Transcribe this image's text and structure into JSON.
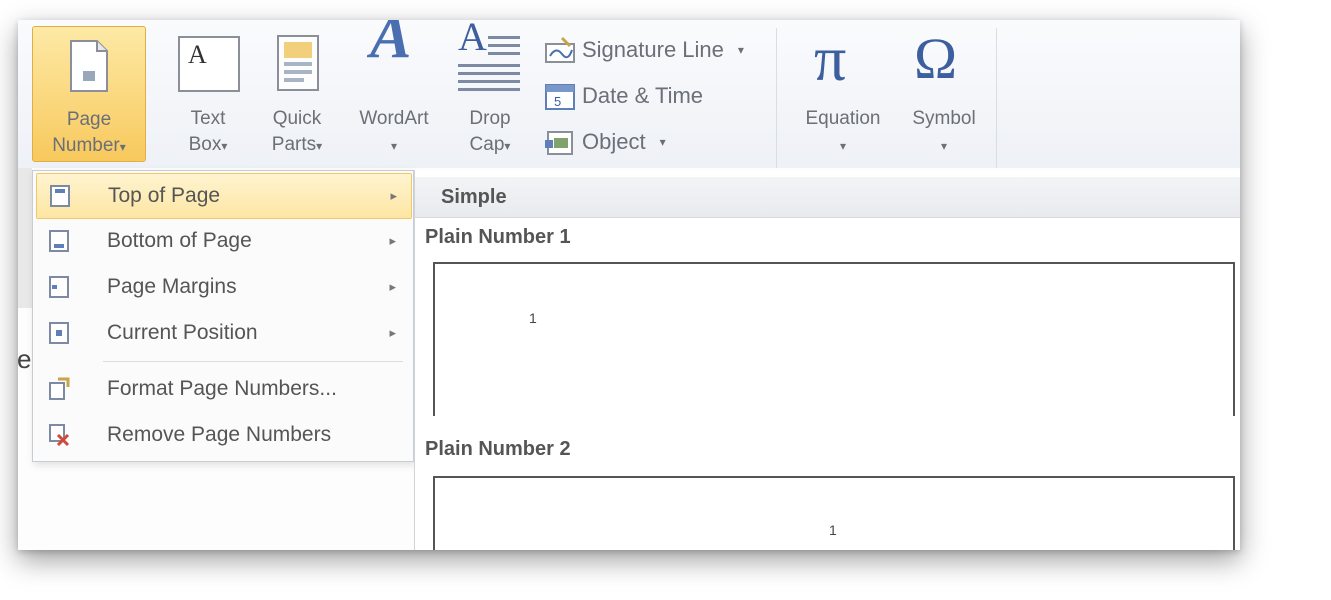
{
  "ribbon": {
    "page_number": {
      "line1": "Page",
      "line2": "Number",
      "arrow": "▾",
      "icon": "page-number-icon"
    },
    "text_box": {
      "line1": "Text",
      "line2": "Box",
      "arrow": "▾",
      "icon": "text-box-icon",
      "glyph": "A"
    },
    "quick_parts": {
      "line1": "Quick",
      "line2": "Parts",
      "arrow": "▾",
      "icon": "quick-parts-icon"
    },
    "wordart": {
      "line1": "WordArt",
      "arrow": "▾",
      "icon": "wordart-icon",
      "glyph": "A"
    },
    "drop_cap": {
      "line1": "Drop",
      "line2": "Cap",
      "arrow": "▾",
      "icon": "drop-cap-icon",
      "glyph": "A"
    },
    "signature_line": {
      "label": "Signature Line",
      "arrow": "▾",
      "icon": "signature-icon"
    },
    "date_time": {
      "label": "Date & Time",
      "icon": "calendar-icon"
    },
    "object": {
      "label": "Object",
      "arrow": "▾",
      "icon": "object-icon"
    },
    "equation": {
      "label": "Equation",
      "arrow": "▾",
      "icon": "pi-icon",
      "glyph": "π"
    },
    "symbol": {
      "label": "Symbol",
      "arrow": "▾",
      "icon": "omega-icon",
      "glyph": "Ω"
    }
  },
  "menu": {
    "items": [
      {
        "label": "Top of Page",
        "submenu": "▸",
        "highlighted": true,
        "icon": "top-of-page-icon"
      },
      {
        "label": "Bottom of Page",
        "submenu": "▸",
        "icon": "bottom-of-page-icon"
      },
      {
        "label": "Page Margins",
        "submenu": "▸",
        "icon": "page-margins-icon"
      },
      {
        "label": "Current Position",
        "submenu": "▸",
        "icon": "current-position-icon"
      },
      {
        "label": "Format Page Numbers...",
        "icon": "format-page-numbers-icon"
      },
      {
        "label": "Remove Page Numbers",
        "icon": "remove-page-numbers-icon"
      }
    ]
  },
  "gallery": {
    "header": "Simple",
    "items": [
      {
        "title": "Plain Number 1",
        "number": "1"
      },
      {
        "title": "Plain Number 2",
        "number": "1"
      }
    ]
  },
  "document": {
    "glyph": "e"
  },
  "colors": {
    "highlight": "#fde6a3",
    "active_button": "#f8c95d",
    "ribbon_bg": "#eef1f6"
  }
}
